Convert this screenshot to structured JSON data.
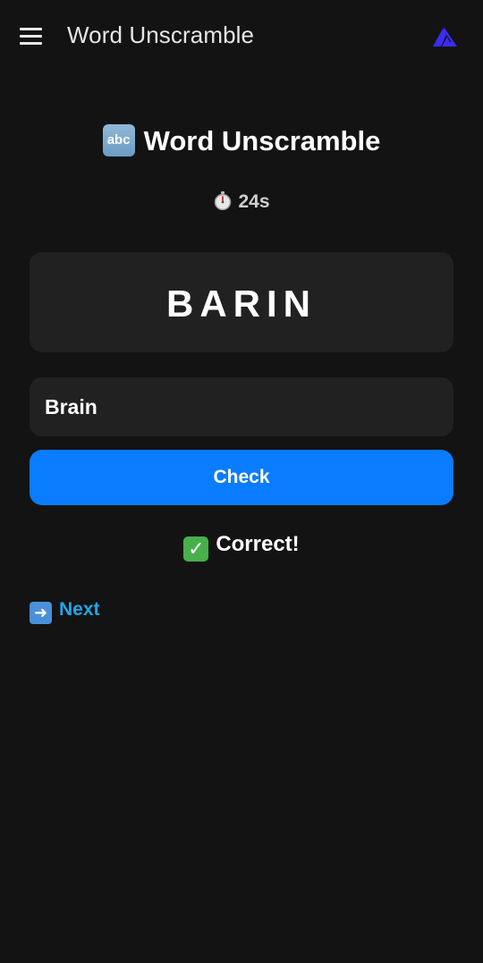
{
  "app_bar": {
    "title": "Word Unscramble",
    "menu_icon": "hamburger-menu-icon",
    "logo_icon": "app-logo-icon",
    "logo_color": "#3b2cf0"
  },
  "game": {
    "heading_icon": "abc",
    "heading": "Word Unscramble",
    "timer": "24s",
    "scrambled_word": "BARIN",
    "answer_value": "Brain",
    "check_label": "Check",
    "result_text": "Correct!",
    "next_label": "Next"
  },
  "colors": {
    "background": "#131313",
    "card": "#212121",
    "accent": "#0a7cff",
    "link": "#1ba8ec",
    "success": "#47b04a"
  }
}
